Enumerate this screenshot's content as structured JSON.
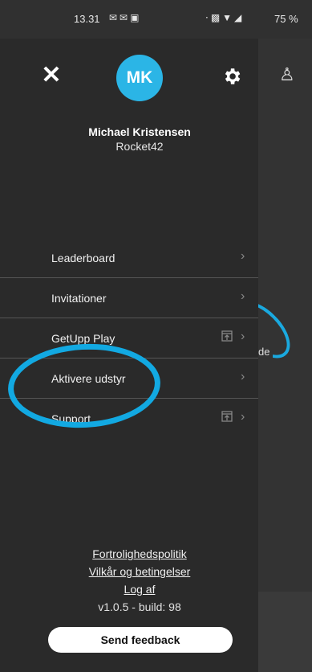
{
  "status_bar": {
    "time": "13.31",
    "battery": "75 %"
  },
  "profile": {
    "initials": "MK",
    "name": "Michael Kristensen",
    "subtitle": "Rocket42"
  },
  "menu": [
    {
      "label": "Leaderboard",
      "external": false
    },
    {
      "label": "Invitationer",
      "external": false
    },
    {
      "label": "GetUpp Play",
      "external": true
    },
    {
      "label": "Aktivere udstyr",
      "external": false
    },
    {
      "label": "Support",
      "external": true
    }
  ],
  "footer": {
    "privacy": "Fortrolighedspolitik",
    "terms": "Vilkår og betingelser",
    "logout": "Log af",
    "version": "v1.0.5 - build: 98"
  },
  "feedback_button": "Send feedback",
  "backdrop": {
    "peek_text": "de"
  },
  "colors": {
    "accent": "#2bb5e6",
    "highlight": "#12a9e2",
    "drawer_bg": "#2a2a2a"
  }
}
